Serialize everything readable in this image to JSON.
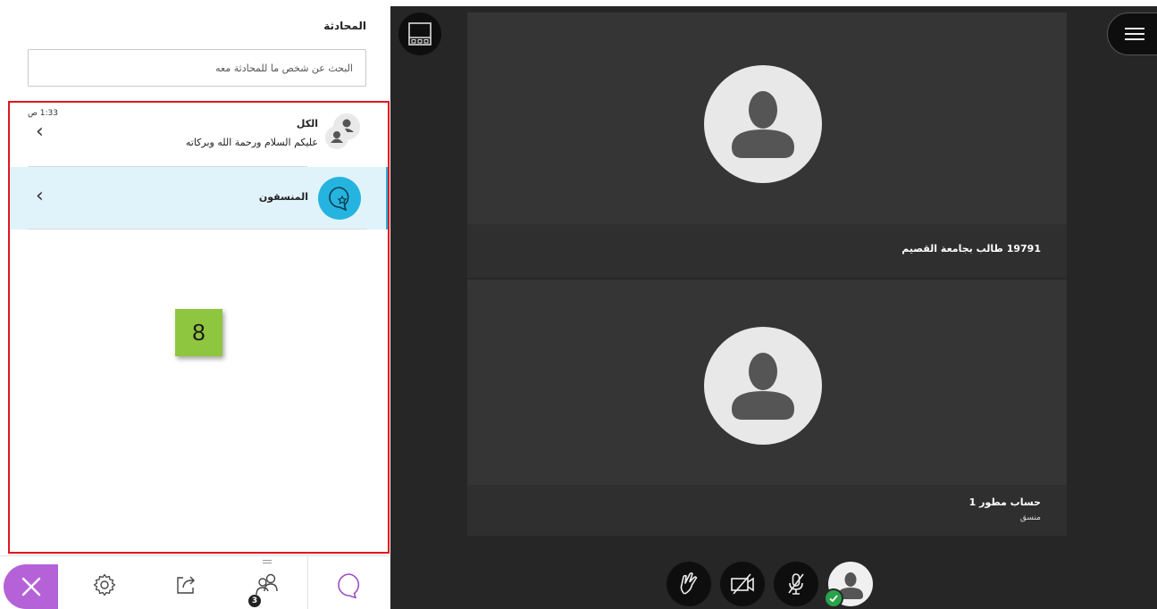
{
  "chat": {
    "title": "المحادثة",
    "search_placeholder": "البحث عن شخص ما للمحادثة معه",
    "conversations": [
      {
        "name": "الكل",
        "last_message": "عليكم السلام ورحمة الله وبركاته",
        "time": "1:33 ص",
        "icon": "group-avatar-icon"
      },
      {
        "name": "المنسقون",
        "icon": "moderator-chat-icon",
        "selected": true
      }
    ],
    "annotation_badge": "8"
  },
  "toolbar": {
    "items": [
      "close-icon",
      "gear-icon",
      "share-icon",
      "people-icon",
      "chat-icon"
    ],
    "participants_count": "3"
  },
  "video": {
    "tiles": [
      {
        "name": "19791 طالب بجامعة القصيم"
      },
      {
        "name": "حساب مطور 1",
        "role": "منسق"
      }
    ],
    "controls": [
      "raise-hand-icon",
      "camera-off-icon",
      "mic-off-icon",
      "self-avatar-icon"
    ]
  },
  "colors": {
    "accent_blue": "#25b4e0",
    "close_purple": "#b562d8",
    "badge_green": "#8ec63f",
    "highlight_frame": "#e0171f",
    "video_bg": "#262626"
  }
}
